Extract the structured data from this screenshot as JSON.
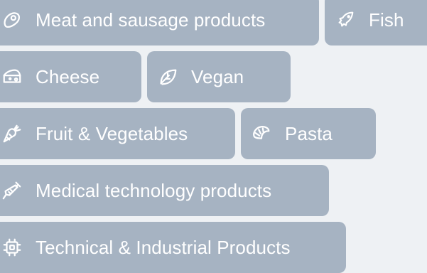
{
  "categories": [
    {
      "id": "meat",
      "label": "Meat and sausage products",
      "icon": "meat-icon"
    },
    {
      "id": "fish",
      "label": "Fish",
      "icon": "fish-icon"
    },
    {
      "id": "cheese",
      "label": "Cheese",
      "icon": "cheese-icon"
    },
    {
      "id": "vegan",
      "label": "Vegan",
      "icon": "leaf-icon"
    },
    {
      "id": "fruit",
      "label": "Fruit & Vegetables",
      "icon": "carrot-icon"
    },
    {
      "id": "pasta",
      "label": "Pasta",
      "icon": "croissant-icon"
    },
    {
      "id": "medical",
      "label": "Medical technology products",
      "icon": "syringe-icon"
    },
    {
      "id": "technical",
      "label": "Technical & Industrial Products",
      "icon": "chip-icon"
    }
  ],
  "colors": {
    "background": "#eef1f4",
    "pill": "#a6b3c2",
    "text": "#ffffff"
  }
}
